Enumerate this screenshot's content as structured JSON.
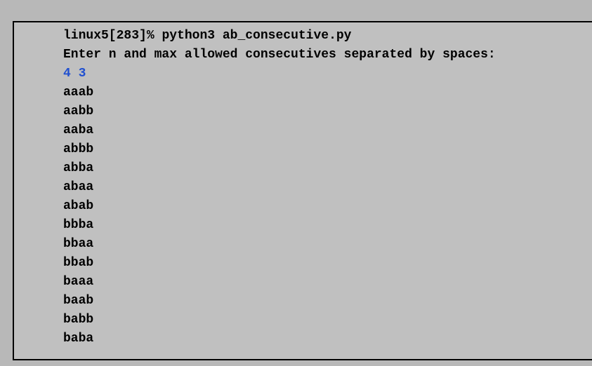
{
  "terminal": {
    "prompt": "linux5[283]% ",
    "command": "python3 ab_consecutive.py",
    "program_prompt": "Enter n and max allowed consecutives separated by spaces:",
    "user_input": "4 3",
    "output": [
      "aaab",
      "aabb",
      "aaba",
      "abbb",
      "abba",
      "abaa",
      "abab",
      "bbba",
      "bbaa",
      "bbab",
      "baaa",
      "baab",
      "babb",
      "baba"
    ]
  }
}
